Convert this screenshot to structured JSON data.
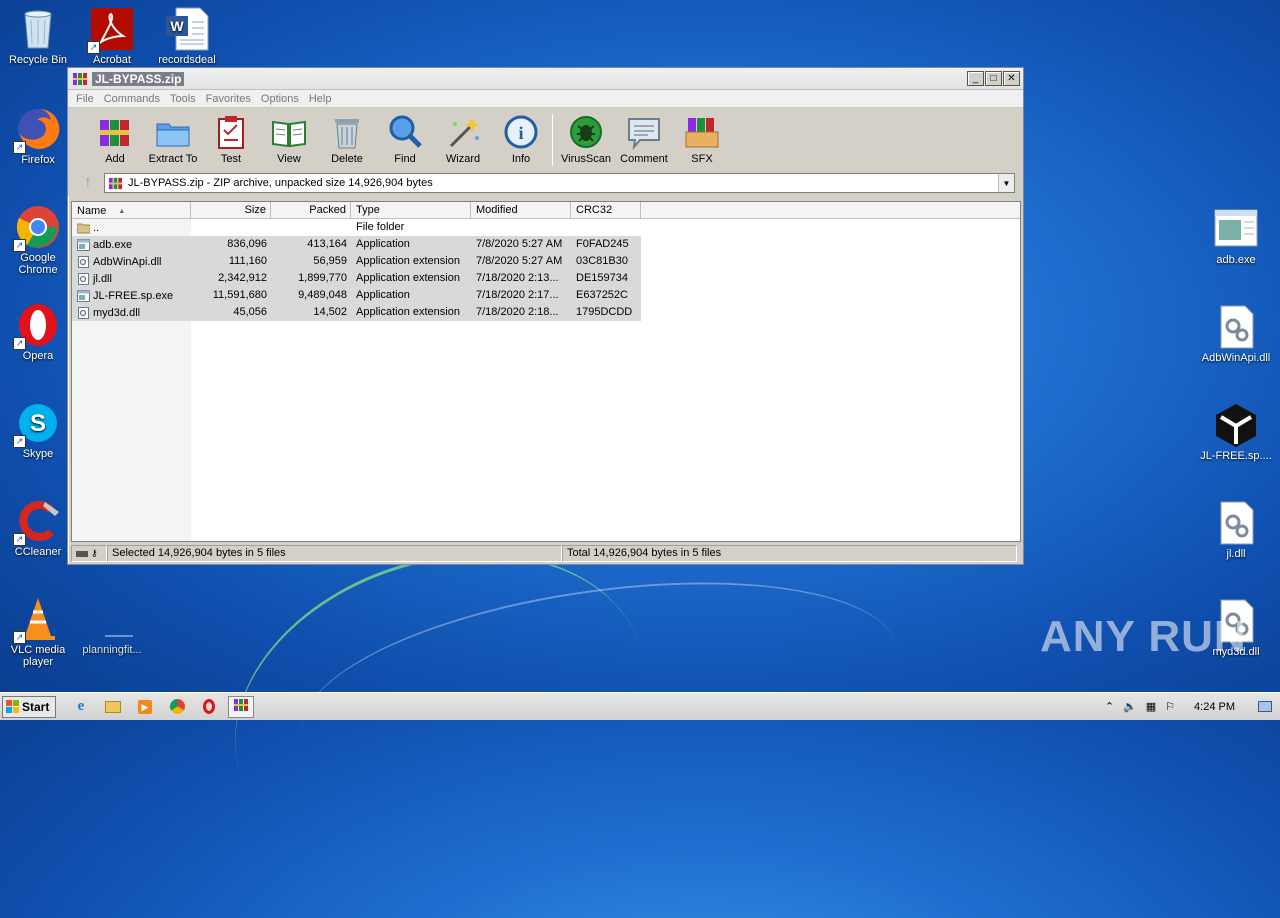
{
  "desktop": {
    "left_icons": [
      {
        "label": "Recycle Bin"
      },
      {
        "label": "Acrobat"
      },
      {
        "label": "recordsdeal"
      },
      {
        "label": "Firefox"
      },
      {
        "label": "Google Chrome"
      },
      {
        "label": "Opera"
      },
      {
        "label": "Skype"
      },
      {
        "label": "CCleaner"
      },
      {
        "label": "VLC media player"
      },
      {
        "label": "planningfit..."
      }
    ],
    "right_icons": [
      {
        "label": "adb.exe"
      },
      {
        "label": "AdbWinApi.dll"
      },
      {
        "label": "JL-FREE.sp...."
      },
      {
        "label": "jl.dll"
      },
      {
        "label": "myd3d.dll"
      }
    ],
    "watermark": "ANY RUN"
  },
  "window": {
    "title": "JL-BYPASS.zip",
    "controls": [
      "_",
      "□",
      "✕"
    ],
    "menu": [
      "File",
      "Commands",
      "Tools",
      "Favorites",
      "Options",
      "Help"
    ],
    "toolbar": [
      {
        "label": "Add",
        "icon": "add-archive-icon"
      },
      {
        "label": "Extract To",
        "icon": "extract-folder-icon"
      },
      {
        "label": "Test",
        "icon": "test-clipboard-icon"
      },
      {
        "label": "View",
        "icon": "view-book-icon"
      },
      {
        "label": "Delete",
        "icon": "trash-icon"
      },
      {
        "label": "Find",
        "icon": "magnifier-icon"
      },
      {
        "label": "Wizard",
        "icon": "wand-icon"
      },
      {
        "label": "Info",
        "icon": "info-icon"
      },
      {
        "label": "VirusScan",
        "icon": "virus-icon"
      },
      {
        "label": "Comment",
        "icon": "comment-icon"
      },
      {
        "label": "SFX",
        "icon": "sfx-box-icon"
      }
    ],
    "address": "JL-BYPASS.zip - ZIP archive, unpacked size 14,926,904 bytes",
    "columns": [
      "Name",
      "Size",
      "Packed",
      "Type",
      "Modified",
      "CRC32"
    ],
    "sort_indicator": "▲",
    "files": [
      {
        "name": "..",
        "size": "",
        "packed": "",
        "type": "File folder",
        "modified": "",
        "crc": "",
        "kind": "folder"
      },
      {
        "name": "adb.exe",
        "size": "836,096",
        "packed": "413,164",
        "type": "Application",
        "modified": "7/8/2020 5:27 AM",
        "crc": "F0FAD245",
        "kind": "exe"
      },
      {
        "name": "AdbWinApi.dll",
        "size": "111,160",
        "packed": "56,959",
        "type": "Application extension",
        "modified": "7/8/2020 5:27 AM",
        "crc": "03C81B30",
        "kind": "dll"
      },
      {
        "name": "jl.dll",
        "size": "2,342,912",
        "packed": "1,899,770",
        "type": "Application extension",
        "modified": "7/18/2020 2:13...",
        "crc": "DE159734",
        "kind": "dll"
      },
      {
        "name": "JL-FREE.sp.exe",
        "size": "11,591,680",
        "packed": "9,489,048",
        "type": "Application",
        "modified": "7/18/2020 2:17...",
        "crc": "E637252C",
        "kind": "exe"
      },
      {
        "name": "myd3d.dll",
        "size": "45,056",
        "packed": "14,502",
        "type": "Application extension",
        "modified": "7/18/2020 2:18...",
        "crc": "1795DCDD",
        "kind": "dll"
      }
    ],
    "status_left": "Selected 14,926,904 bytes in 5 files",
    "status_right": "Total 14,926,904 bytes in 5 files"
  },
  "taskbar": {
    "start_label": "Start",
    "time": "4:24 PM"
  }
}
